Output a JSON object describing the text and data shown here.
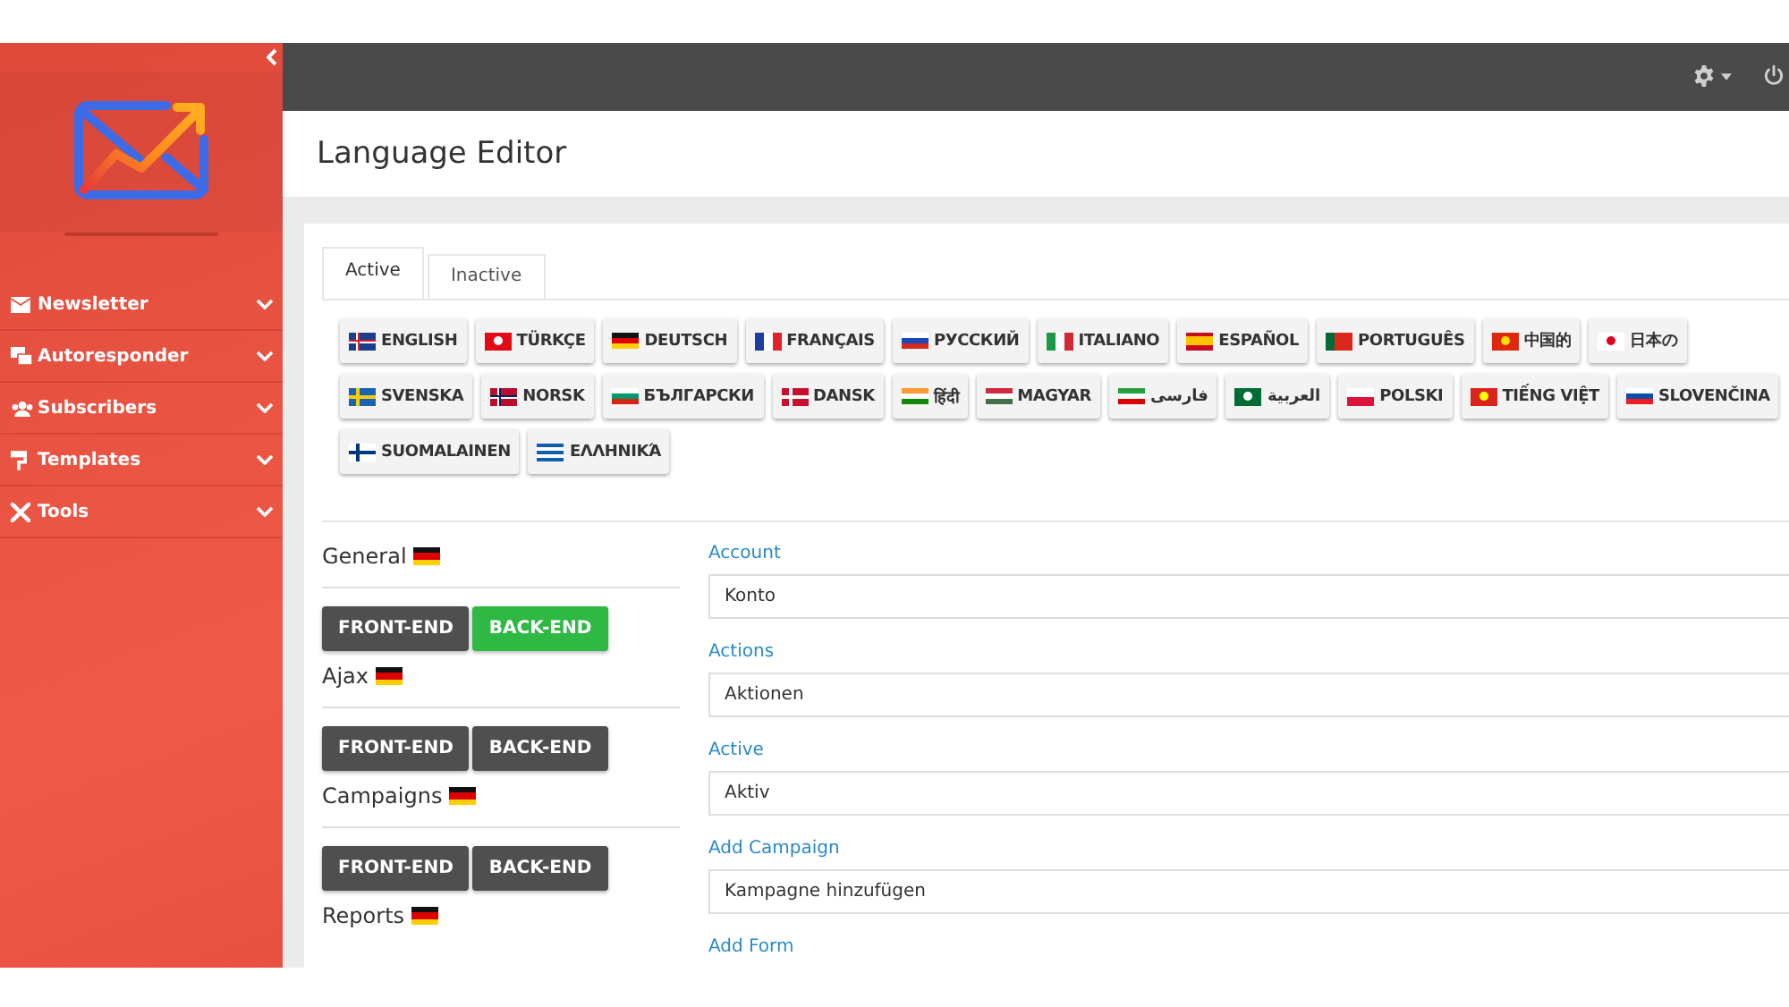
{
  "sidebar": {
    "items": [
      {
        "label": "Newsletter"
      },
      {
        "label": "Autoresponder"
      },
      {
        "label": "Subscribers"
      },
      {
        "label": "Templates"
      },
      {
        "label": "Tools"
      }
    ]
  },
  "page": {
    "title": "Language Editor"
  },
  "tabs": [
    {
      "label": "Active",
      "selected": true
    },
    {
      "label": "Inactive",
      "selected": false
    }
  ],
  "languages": [
    {
      "label": "ENGLISH"
    },
    {
      "label": "TÜRKÇE"
    },
    {
      "label": "DEUTSCH"
    },
    {
      "label": "FRANÇAIS"
    },
    {
      "label": "РУССКИЙ"
    },
    {
      "label": "ITALIANO"
    },
    {
      "label": "ESPAÑOL"
    },
    {
      "label": "PORTUGUÊS"
    },
    {
      "label": "中国的"
    },
    {
      "label": "日本の"
    },
    {
      "label": "SVENSKA"
    },
    {
      "label": "NORSK"
    },
    {
      "label": "БЪЛГАРСКИ"
    },
    {
      "label": "DANSK"
    },
    {
      "label": "हिंदी"
    },
    {
      "label": "MAGYAR"
    },
    {
      "label": "فارسی"
    },
    {
      "label": "العربية"
    },
    {
      "label": "POLSKI"
    },
    {
      "label": "TIẾNG VIỆT"
    },
    {
      "label": "SLOVENČINA"
    },
    {
      "label": "SUOMALAINEN"
    },
    {
      "label": "ΕΛΛΗΝΙΚΆ"
    }
  ],
  "sections": [
    {
      "title": "General",
      "buttons": [
        {
          "label": "FRONT-END",
          "selected": false
        },
        {
          "label": "BACK-END",
          "selected": true
        }
      ]
    },
    {
      "title": "Ajax",
      "buttons": [
        {
          "label": "FRONT-END",
          "selected": false
        },
        {
          "label": "BACK-END",
          "selected": false
        }
      ]
    },
    {
      "title": "Campaigns",
      "buttons": [
        {
          "label": "FRONT-END",
          "selected": false
        },
        {
          "label": "BACK-END",
          "selected": false
        }
      ]
    },
    {
      "title": "Reports"
    }
  ],
  "fields": [
    {
      "label": "Account",
      "value": "Konto"
    },
    {
      "label": "Actions",
      "value": "Aktionen"
    },
    {
      "label": "Active",
      "value": "Aktiv"
    },
    {
      "label": "Add Campaign",
      "value": "Kampagne hinzufügen"
    },
    {
      "label": "Add Form"
    }
  ]
}
